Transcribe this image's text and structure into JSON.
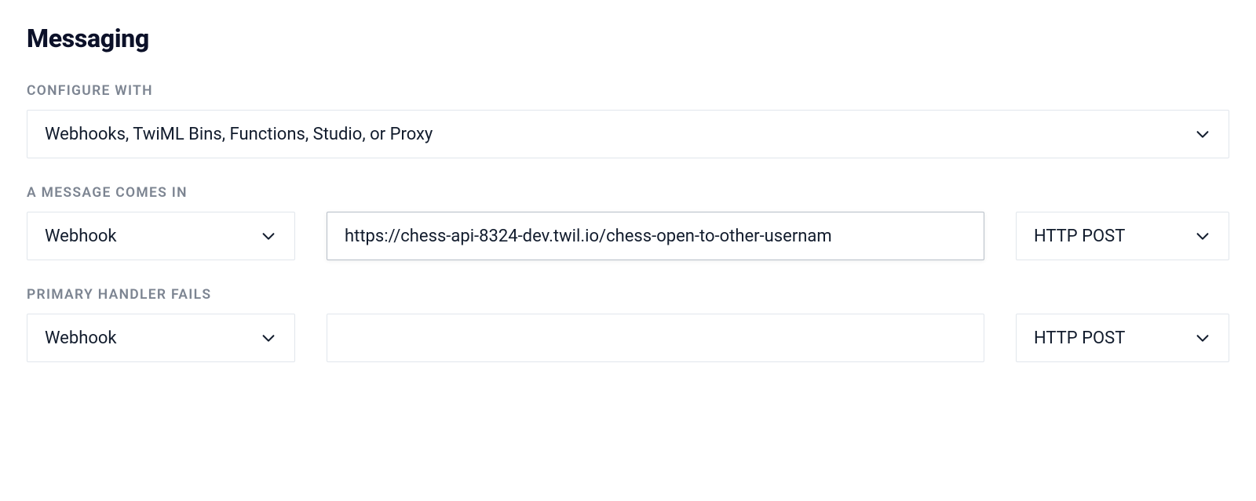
{
  "section": {
    "title": "Messaging"
  },
  "configureWith": {
    "label": "CONFIGURE WITH",
    "value": "Webhooks, TwiML Bins, Functions, Studio, or Proxy"
  },
  "messageComesIn": {
    "label": "A MESSAGE COMES IN",
    "handlerType": "Webhook",
    "url": "https://chess-api-8324-dev.twil.io/chess-open-to-other-usernam",
    "method": "HTTP POST"
  },
  "primaryHandlerFails": {
    "label": "PRIMARY HANDLER FAILS",
    "handlerType": "Webhook",
    "url": "",
    "method": "HTTP POST"
  }
}
